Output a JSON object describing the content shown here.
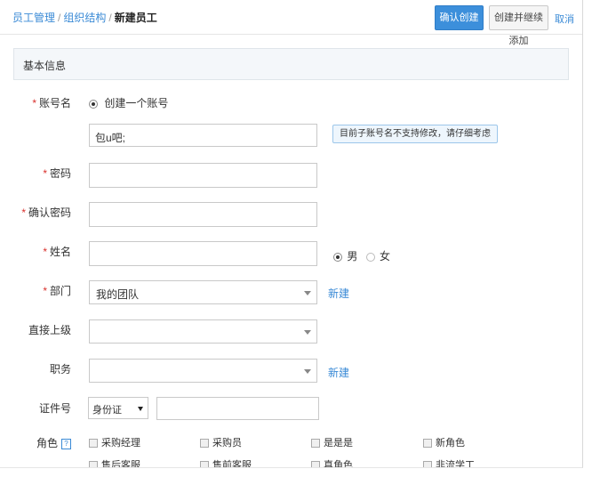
{
  "breadcrumb": {
    "item1": "员工管理",
    "item2": "组织结构",
    "current": "新建员工",
    "sep": "/"
  },
  "actions": {
    "confirm": "确认创建",
    "create_continue": "创建并继续添加",
    "cancel": "取消"
  },
  "section_title": "基本信息",
  "form": {
    "account": {
      "label": "账号名",
      "radio_label": "创建一个账号",
      "value": "包u吧;"
    },
    "tip": "目前子账号名不支持修改，请仔细考虑",
    "password": {
      "label": "密码",
      "value": ""
    },
    "confirm_password": {
      "label": "确认密码",
      "value": ""
    },
    "name": {
      "label": "姓名",
      "value": "",
      "gender_male": "男",
      "gender_female": "女"
    },
    "department": {
      "label": "部门",
      "value": "我的团队",
      "new_link": "新建"
    },
    "superior": {
      "label": "直接上级",
      "value": ""
    },
    "position": {
      "label": "职务",
      "value": "",
      "new_link": "新建"
    },
    "id_number": {
      "label": "证件号",
      "type": "身份证",
      "value": ""
    },
    "roles": {
      "label": "角色",
      "help": "?",
      "row1": [
        "采购经理",
        "采购员",
        "是是是",
        "新角色"
      ],
      "row2": [
        "售后客服",
        "售前客服",
        "真角色",
        "非流学工"
      ]
    },
    "required_mark": "*"
  }
}
